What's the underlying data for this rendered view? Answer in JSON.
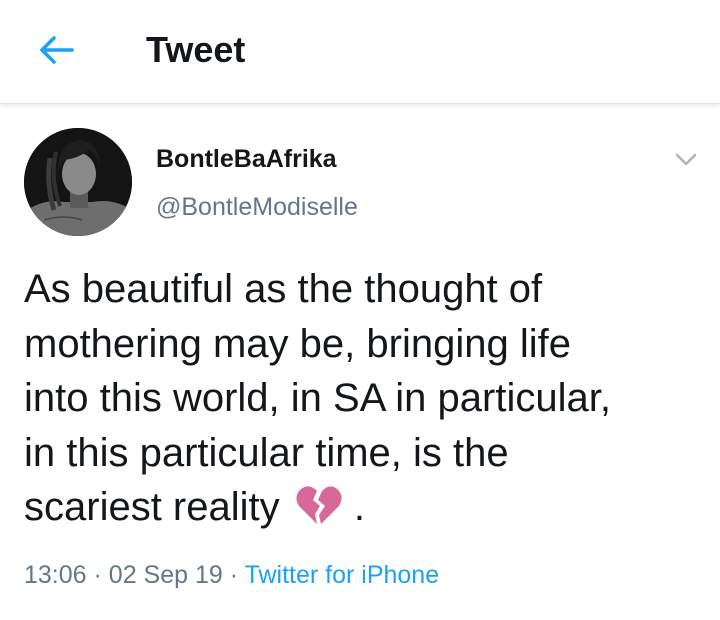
{
  "header": {
    "title": "Tweet",
    "back_icon": "arrow-left-icon",
    "accent_color": "#1da1f2"
  },
  "tweet": {
    "display_name": "BontleBaAfrika",
    "handle": "@BontleModiselle",
    "text_lines": [
      "As beautiful as the thought of",
      "mothering may be, bringing life",
      "into this world, in SA in particular,",
      "in this particular time, is the",
      "scariest reality"
    ],
    "text_end": ".",
    "emoji": "broken-heart-icon",
    "time": "13:06",
    "separator": "·",
    "date": "02 Sep 19",
    "source": "Twitter for iPhone",
    "menu_icon": "chevron-down-icon"
  }
}
